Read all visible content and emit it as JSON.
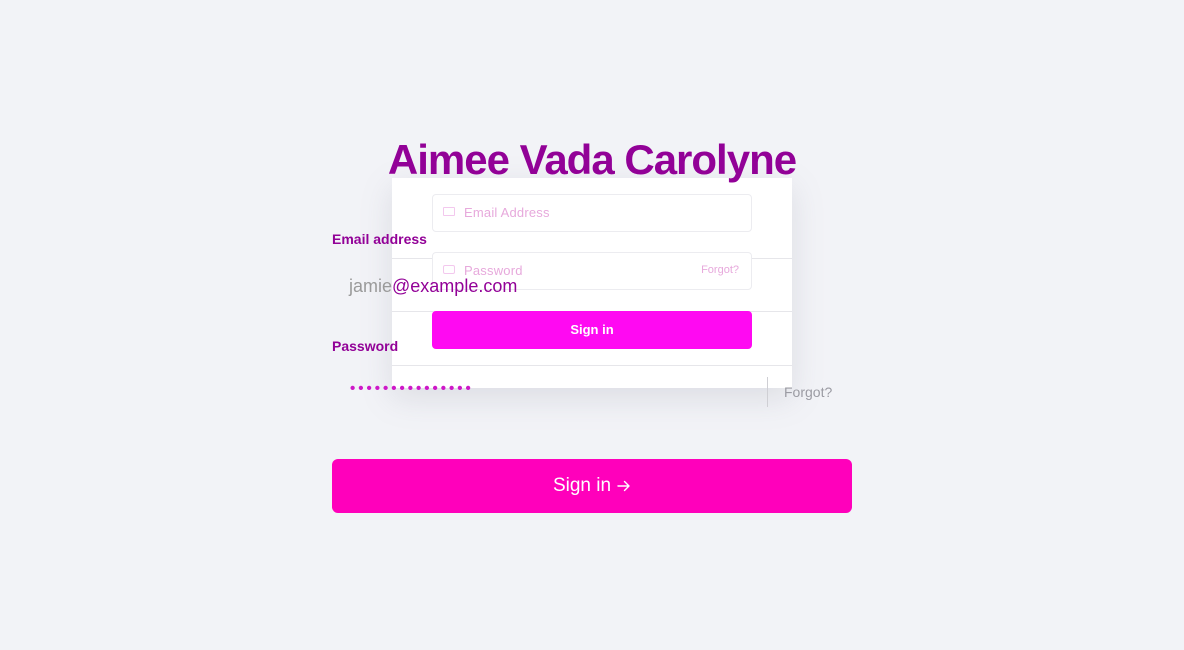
{
  "brand": {
    "title": "Aimee Vada Carolyne"
  },
  "ghost_form": {
    "email_placeholder": "Email Address",
    "password_placeholder": "Password",
    "forgot_label": "Forgot?",
    "signin_label": "Sign in"
  },
  "form": {
    "email_label": "Email address",
    "email_value_user": "jamie",
    "email_value_domain": "@example.com",
    "password_label": "Password",
    "password_masked": "•••••••••••••••",
    "forgot_label": "Forgot?",
    "signin_label": "Sign in",
    "signin_icon": "arrow-right-icon"
  },
  "colors": {
    "background": "#f2f3f7",
    "brand": "#920197",
    "accent": "#ff00bb",
    "ghost_accent": "#ff09f2"
  }
}
